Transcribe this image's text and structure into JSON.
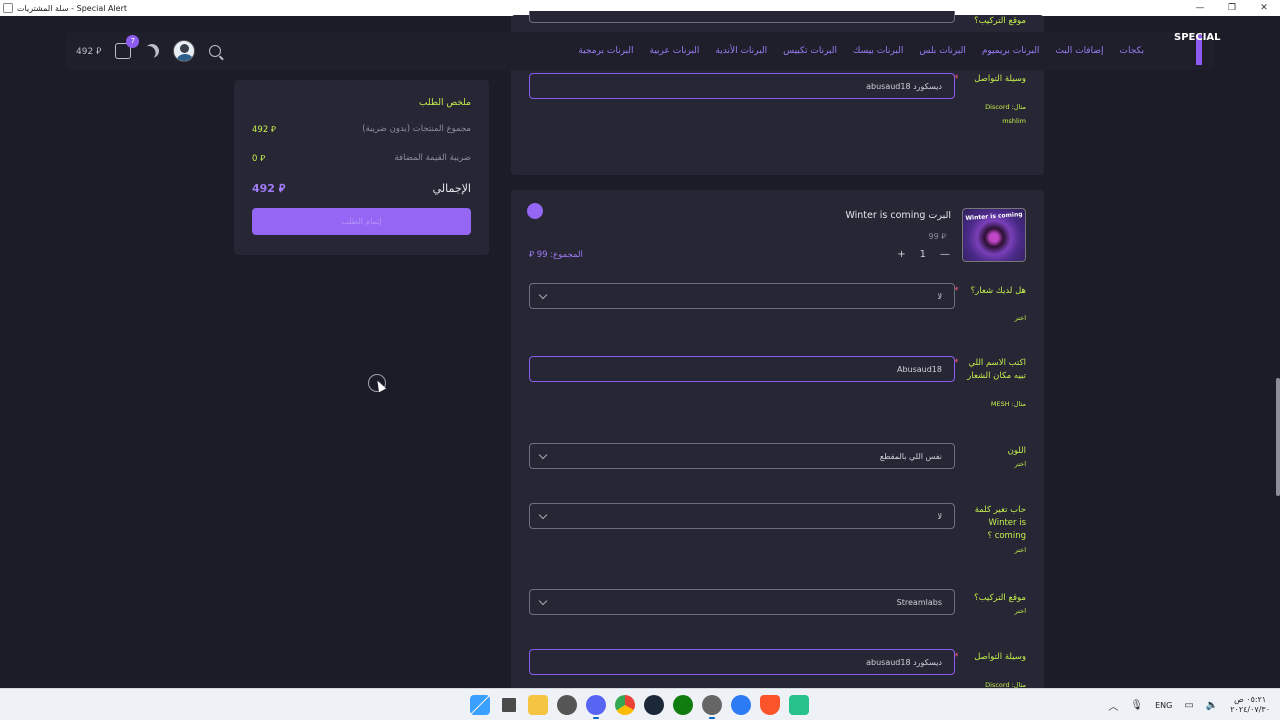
{
  "window": {
    "title": "سلة المشتريات - Special Alert",
    "controls": [
      "—",
      "❐",
      "✕"
    ]
  },
  "header": {
    "logo_text": "SPECIAL",
    "nav": [
      "بكجات",
      "إضافات البث",
      "البرنات بريميوم",
      "البرنات بلس",
      "البرنات بيسك",
      "البرنات تكبيس",
      "البرنات الأندية",
      "البرنات عربية",
      "البرنات برمجية"
    ],
    "cart_total": "492 ⃁",
    "cart_count": "7"
  },
  "summary": {
    "title": "ملخص الطلب",
    "subtotal_label": "مجموع المنتجات (بدون ضريبة)",
    "subtotal_value": "492 ⃁",
    "vat_label": "ضريبة القيمة المضافة",
    "vat_value": "0 ⃁",
    "total_label": "الإجمالي",
    "total_value": "492 ⃁",
    "checkout_label": "إتمام الطلب"
  },
  "card1": {
    "partial_label": "موقع التركيب؟",
    "contact_label": "وسيلة التواصل",
    "contact_value": "ديسكورد abusaud18",
    "contact_hint": "مثال: Discord",
    "contact_hint2": "mshlim"
  },
  "card2": {
    "product_name": "البرت Winter is coming",
    "product_thumb_text": "Winter is coming",
    "price": "99 ⃁",
    "qty": "1",
    "qty_minus": "—",
    "qty_plus": "+",
    "subtotal": "المجموع: 99 ⃁",
    "fields": {
      "logo_q": "هل لديك شعار؟",
      "logo_hint": "اختر",
      "logo_value": "لا",
      "name_q": "اكتب الاسم اللي تبيه مكان الشعار",
      "name_hint": "مثال: MESH",
      "name_value": "Abusaud18",
      "color_q": "اللون",
      "color_hint": "اختر",
      "color_value": "نفس اللي بالمقطع",
      "word_q": "حاب تغير كلمة Winter is coming ؟",
      "word_hint": "اختر",
      "word_value": "لا",
      "install_q": "موقع التركيب؟",
      "install_hint": "اختر",
      "install_value": "Streamlabs",
      "contact_q": "وسيلة التواصل",
      "contact_hint": "مثال: Discord",
      "contact_value": "ديسكورد abusaud18"
    }
  },
  "taskbar": {
    "lang": "ENG",
    "time": "٠٥:٢١ ص",
    "date": "٢٠٢٤/٠٧/٣٠"
  },
  "colors": {
    "accent": "#9565f4",
    "label": "#c5f04e",
    "background": "#1c1c28",
    "card": "#262634"
  }
}
